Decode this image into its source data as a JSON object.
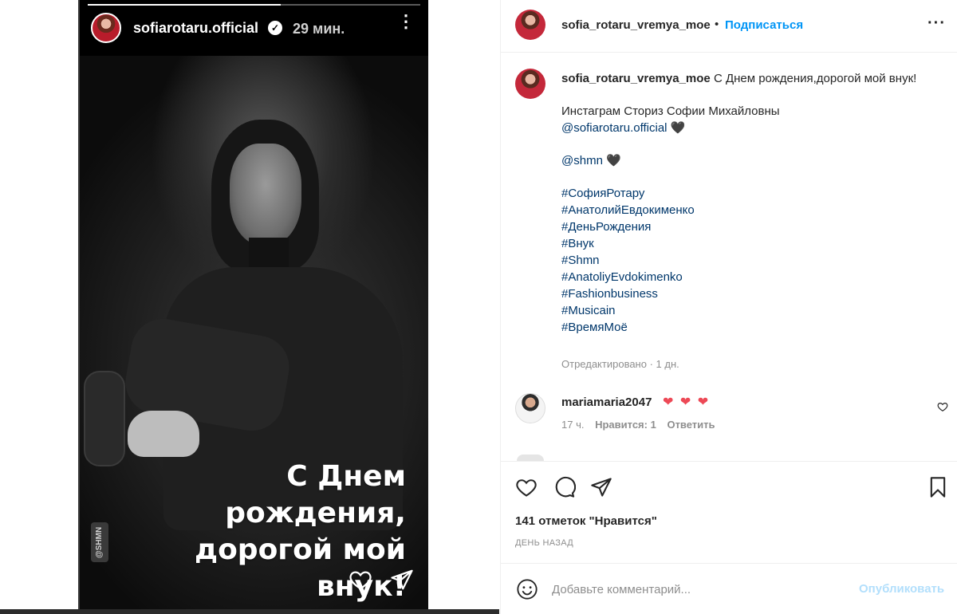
{
  "story": {
    "username": "sofiarotaru.official",
    "verified_icon": "verified-badge-icon",
    "time": "29 мин.",
    "more": "⋮",
    "progress": 0.58,
    "watermark": "@SHMN",
    "caption_lines": [
      "С Днем",
      "рождения,",
      "дорогой мой",
      "внук!"
    ]
  },
  "post": {
    "header": {
      "username": "sofia_rotaru_vremya_moe",
      "separator": "•",
      "follow_label": "Подписаться",
      "more": "···"
    },
    "caption": {
      "username": "sofia_rotaru_vremya_moe",
      "text": "С Днем рождения,дорогой мой внук!",
      "line2": "Инстаграм Сториз Софии Михайловны",
      "mention1": "@sofiarotaru.official",
      "heart1": "🖤",
      "mention2": "@shmn",
      "heart2": "🖤",
      "hashtags": [
        "#СофияРотару",
        "#АнатолийЕвдокименко",
        "#ДеньРождения",
        "#Внук",
        "#Shmn",
        "#AnatoliyEvdokimenko",
        "#Fashionbusiness",
        "#Musicain",
        "#ВремяМоё"
      ],
      "edited": "Отредактировано · 1 дн."
    },
    "comment": {
      "username": "mariamaria2047",
      "text": "❤ ❤ ❤",
      "time": "17 ч.",
      "likes": "Нравится: 1",
      "reply": "Ответить"
    },
    "likes_text": "141 отметок \"Нравится\"",
    "date_text": "ДЕНЬ НАЗАД",
    "comment_placeholder": "Добавьте комментарий...",
    "publish_label": "Опубликовать"
  },
  "colors": {
    "link": "#00376b",
    "follow": "#0095f6",
    "publish_disabled": "#b2dffc",
    "heart_red": "#ed4956"
  }
}
